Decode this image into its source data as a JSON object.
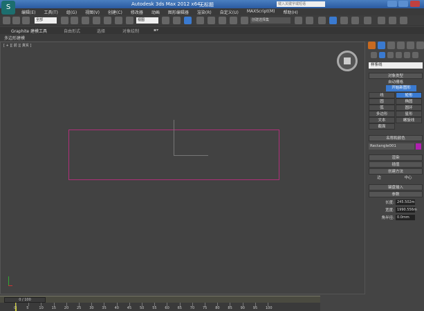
{
  "title": {
    "app": "Autodesk 3ds Max 2012 x64",
    "doc": "无标题",
    "search_placeholder": "键入关键字或短语"
  },
  "menu": [
    "编辑(E)",
    "工具(T)",
    "组(G)",
    "视图(V)",
    "创建(C)",
    "修改器",
    "动画",
    "图形编辑器",
    "渲染(R)",
    "自定义(U)",
    "MAXScript(M)",
    "帮助(H)"
  ],
  "toolbar": {
    "selection_filter": "全部",
    "reference_coord": "视图",
    "named_selection": "创建选择集"
  },
  "ribbon": {
    "tabs": [
      "Graphite 建模工具",
      "自由形式",
      "选择",
      "对象绘制"
    ],
    "subtitle": "多边形建模"
  },
  "viewport": {
    "label": "[ + ][ 前 ][ 真实 ]",
    "accent": "#b0307a"
  },
  "panel": {
    "category": "样条线",
    "object_type": {
      "header": "对象类型",
      "autogrid": "自动栅格",
      "start_new_shape": "开始新图形",
      "buttons": [
        "线",
        "矩形",
        "圆",
        "椭圆",
        "弧",
        "圆环",
        "多边形",
        "星形",
        "文本",
        "螺旋线",
        "截面"
      ],
      "active": "矩形"
    },
    "name_color": {
      "header": "名称和颜色",
      "name": "Rectangle001",
      "color": "#b020b0"
    },
    "rollouts": {
      "rendering": "渲染",
      "interpolation": "插值",
      "creation_method": "创建方法",
      "edge": "边",
      "center": "中心",
      "keyboard_entry": "键盘输入",
      "parameters": "参数"
    },
    "params": [
      {
        "label": "长度:",
        "value": "245.502m"
      },
      {
        "label": "宽度:",
        "value": "1990.556m"
      },
      {
        "label": "角半径:",
        "value": "0.0mm"
      }
    ]
  },
  "timeline": {
    "position": "0 / 100",
    "ticks": [
      "0",
      "5",
      "10",
      "15",
      "20",
      "25",
      "30",
      "35",
      "40",
      "45",
      "50",
      "55",
      "60",
      "65",
      "70",
      "75",
      "80",
      "85",
      "90",
      "95",
      "100"
    ]
  }
}
